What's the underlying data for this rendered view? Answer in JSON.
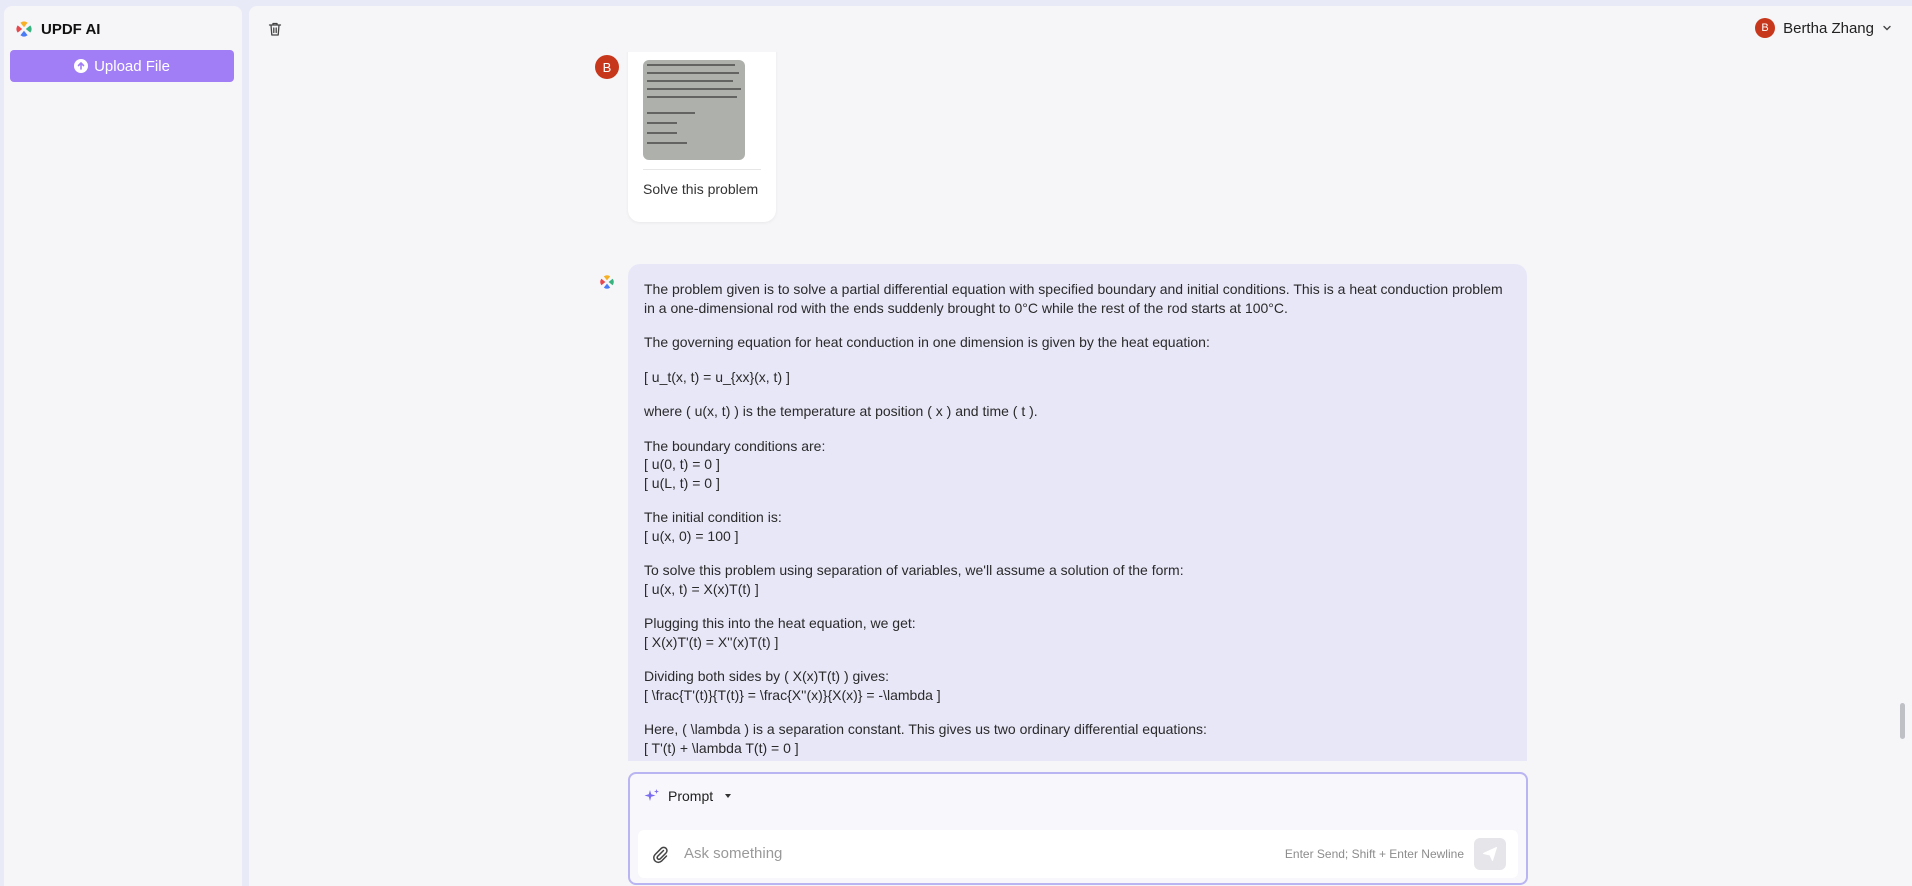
{
  "app": {
    "name": "UPDF AI"
  },
  "sidebar": {
    "upload_label": "Upload File"
  },
  "header": {
    "user_initial": "B",
    "user_name": "Bertha Zhang"
  },
  "conversation": {
    "user_message": {
      "avatar_initial": "B",
      "text": "Solve this problem"
    },
    "ai_paragraphs": [
      "The problem given is to solve a partial differential equation with specified boundary and initial conditions. This is a heat conduction problem in a one-dimensional rod with the ends suddenly brought to 0°C while the rest of the rod starts at 100°C.",
      "The governing equation for heat conduction in one dimension is given by the heat equation:",
      "[ u_t(x, t) = u_{xx}(x, t) ]",
      "where ( u(x, t) ) is the temperature at position ( x ) and time ( t ).",
      "The boundary conditions are:\n[ u(0, t) = 0 ]\n[ u(L, t) = 0 ]",
      "The initial condition is:\n[ u(x, 0) = 100 ]",
      "To solve this problem using separation of variables, we'll assume a solution of the form:\n[ u(x, t) = X(x)T(t) ]",
      "Plugging this into the heat equation, we get:\n[ X(x)T'(t) = X''(x)T(t) ]",
      "Dividing both sides by ( X(x)T(t) ) gives:\n[ \\frac{T'(t)}{T(t)} = \\frac{X''(x)}{X(x)} = -\\lambda ]",
      "Here, ( \\lambda ) is a separation constant. This gives us two ordinary differential equations:\n[ T'(t) + \\lambda T(t) = 0 ]"
    ]
  },
  "composer": {
    "prompt_label": "Prompt",
    "input_value": "",
    "input_placeholder": "Ask something",
    "hint": "Enter Send; Shift + Enter Newline"
  },
  "colors": {
    "accent": "#a17df6",
    "avatar": "#c7371b",
    "ai_bubble": "#e8e7f8",
    "input_border": "#b9b4f2"
  },
  "icons": [
    "updf-logo-icon",
    "upload-icon",
    "trash-icon",
    "chevron-down-icon",
    "ai-logo-icon",
    "sparkle-icon",
    "caret-down-icon",
    "paperclip-icon",
    "send-icon"
  ]
}
